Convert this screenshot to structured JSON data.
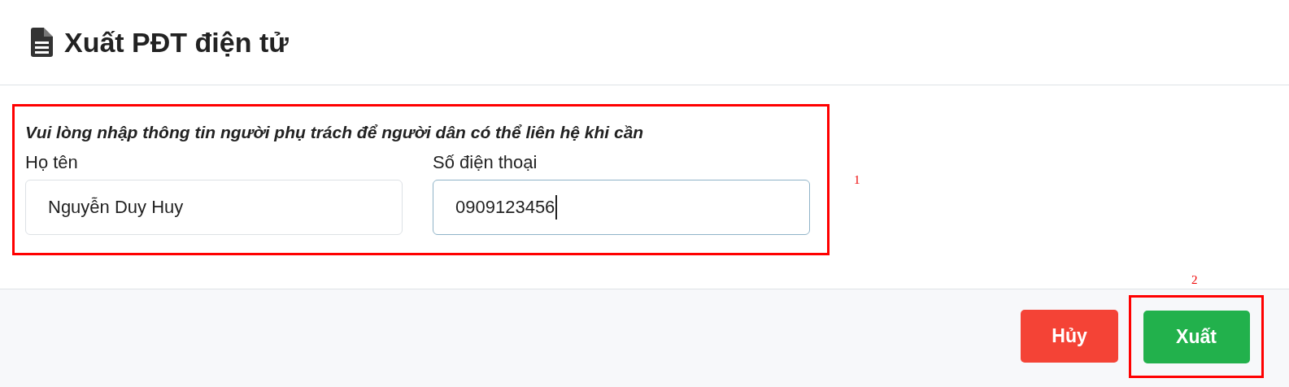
{
  "dialog": {
    "title": "Xuất PĐT điện tử"
  },
  "notice": "Vui lòng nhập thông tin người phụ trách để người dân có thể liên hệ khi cần",
  "fields": [
    {
      "label": "Họ tên",
      "value": "Nguyễn Duy Huy",
      "focused": false
    },
    {
      "label": "Số điện thoại",
      "value": "0909123456",
      "focused": true
    }
  ],
  "markers": [
    "1",
    "2"
  ],
  "buttons": [
    {
      "label": "Hủy",
      "kind": "cancel"
    },
    {
      "label": "Xuất",
      "kind": "submit"
    }
  ]
}
